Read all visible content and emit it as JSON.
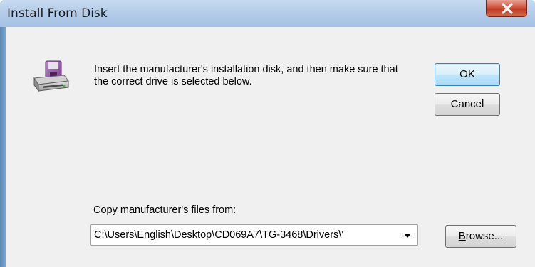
{
  "window": {
    "title": "Install From Disk",
    "close_glyph": "X"
  },
  "dialog": {
    "message": "Insert the manufacturer's installation disk, and then make sure that the correct drive is selected below.",
    "copy_label_mnemonic": "C",
    "copy_label_rest": "opy manufacturer's files from:",
    "path_value": "C:\\Users\\English\\Desktop\\CD069A7\\TG-3468\\Drivers\\'",
    "icon": "floppy-disk-drive-icon"
  },
  "buttons": {
    "ok": "OK",
    "cancel": "Cancel",
    "browse_mnemonic": "B",
    "browse_rest": "rowse..."
  },
  "colors": {
    "titlebar": "#b5cde9",
    "close_button": "#c8452c",
    "dialog_bg": "#f0f0f0",
    "ok_border": "#3c7fb1"
  }
}
